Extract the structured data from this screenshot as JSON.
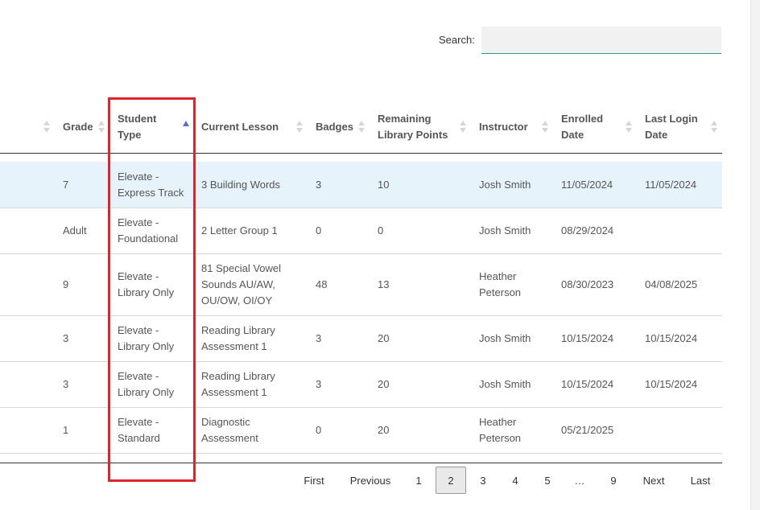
{
  "search": {
    "label": "Search:",
    "placeholder": "",
    "value": ""
  },
  "columns": [
    {
      "label": "Grade"
    },
    {
      "label": "Student Type"
    },
    {
      "label": "Current Lesson"
    },
    {
      "label": "Badges"
    },
    {
      "label": "Remaining Library Points"
    },
    {
      "label": "Instructor"
    },
    {
      "label": "Enrolled Date"
    },
    {
      "label": "Last Login Date"
    }
  ],
  "sort": {
    "column": "Student Type",
    "direction": "ascending"
  },
  "rows": [
    {
      "grade": "7",
      "student_type": "Elevate - Express Track",
      "lesson": "3 Building Words",
      "badges": "3",
      "points": "10",
      "instructor": "Josh Smith",
      "enrolled": "11/05/2024",
      "last_login": "11/05/2024"
    },
    {
      "grade": "Adult",
      "student_type": "Elevate - Foundational",
      "lesson": "2 Letter Group 1",
      "badges": "0",
      "points": "0",
      "instructor": "Josh Smith",
      "enrolled": "08/29/2024",
      "last_login": ""
    },
    {
      "grade": "9",
      "student_type": "Elevate - Library Only",
      "lesson": "81 Special Vowel Sounds AU/AW, OU/OW, OI/OY",
      "badges": "48",
      "points": "13",
      "instructor": "Heather Peterson",
      "enrolled": "08/30/2023",
      "last_login": "04/08/2025"
    },
    {
      "grade": "3",
      "student_type": "Elevate - Library Only",
      "lesson": "Reading Library Assessment 1",
      "badges": "3",
      "points": "20",
      "instructor": "Josh Smith",
      "enrolled": "10/15/2024",
      "last_login": "10/15/2024"
    },
    {
      "grade": "3",
      "student_type": "Elevate - Library Only",
      "lesson": "Reading Library Assessment 1",
      "badges": "3",
      "points": "20",
      "instructor": "Josh Smith",
      "enrolled": "10/15/2024",
      "last_login": "10/15/2024"
    },
    {
      "grade": "1",
      "student_type": "Elevate - Standard",
      "lesson": "Diagnostic Assessment",
      "badges": "0",
      "points": "20",
      "instructor": "Heather Peterson",
      "enrolled": "05/21/2025",
      "last_login": ""
    }
  ],
  "pagination": {
    "first": "First",
    "previous": "Previous",
    "pages": [
      "1",
      "2",
      "3",
      "4",
      "5",
      "…",
      "9"
    ],
    "current": "2",
    "next": "Next",
    "last": "Last"
  },
  "colors": {
    "accent": "#2a9a9a",
    "highlight_row": "#e6f3fb",
    "annotation": "#e0242b",
    "sort_active": "#5a6fd6"
  }
}
